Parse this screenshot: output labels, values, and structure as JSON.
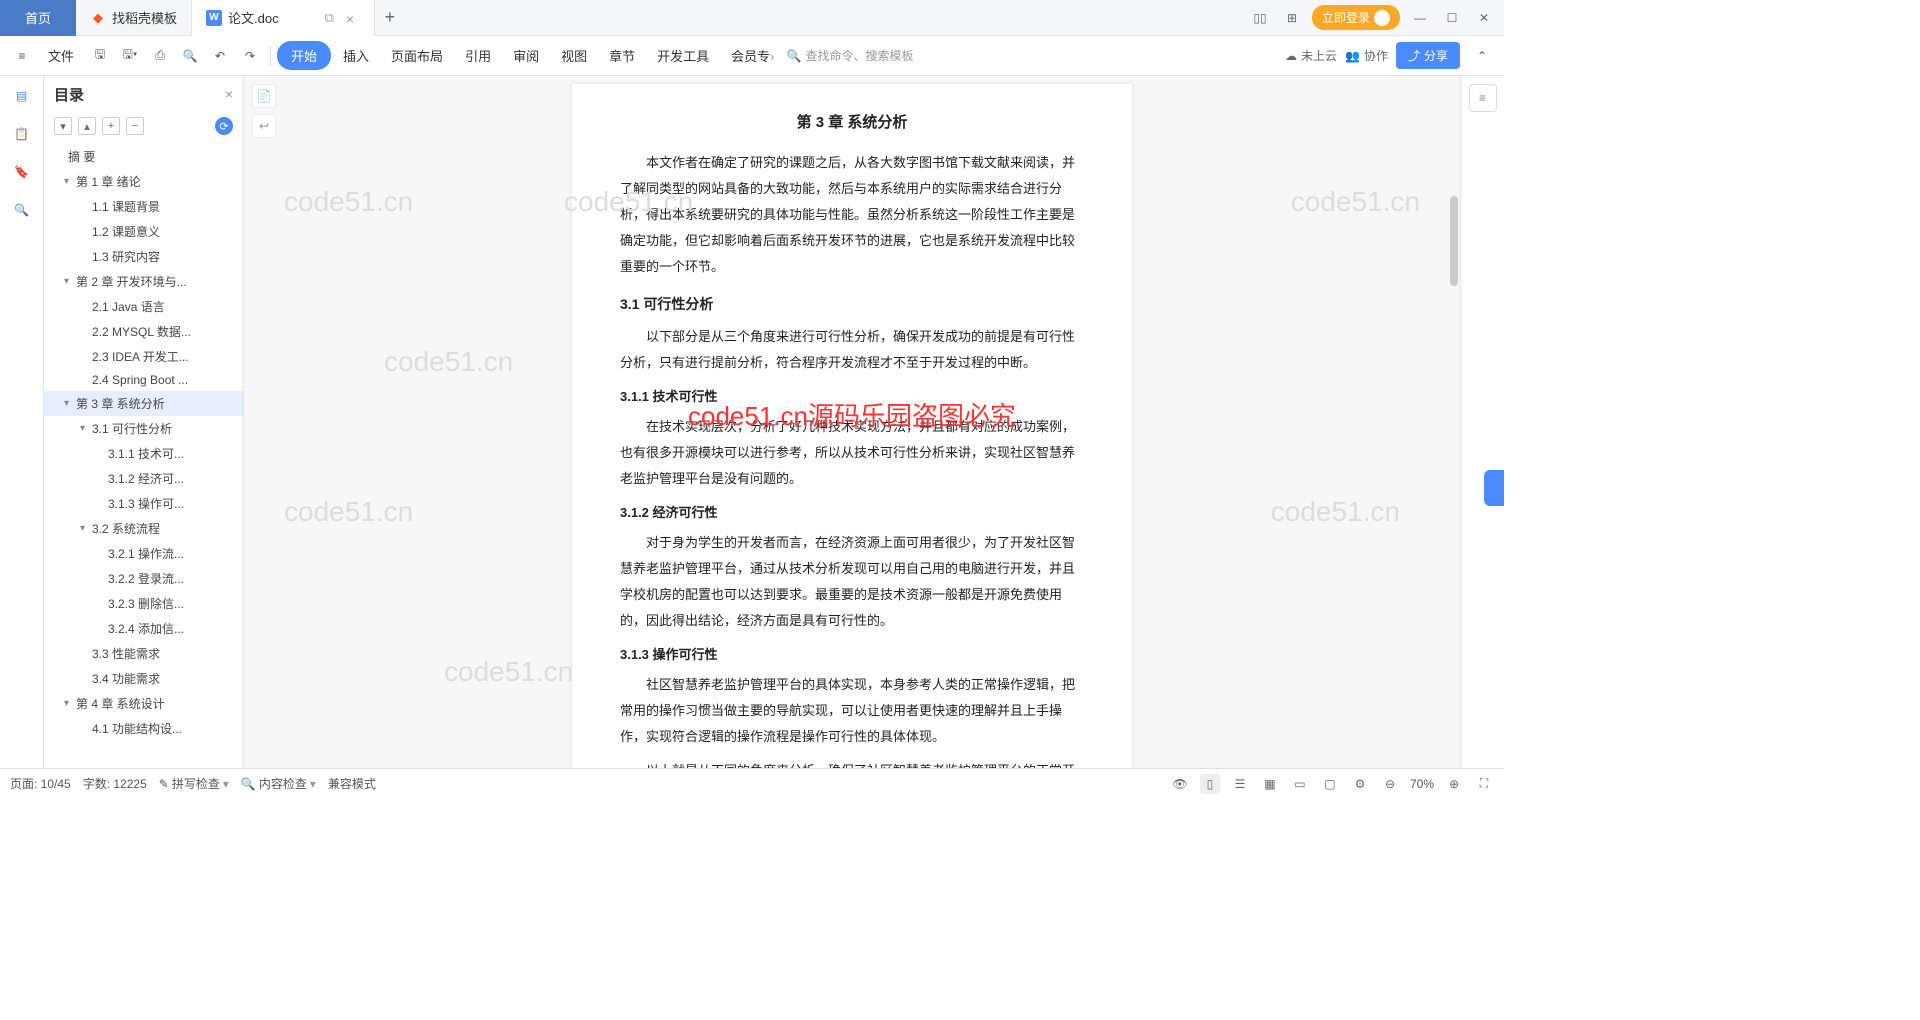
{
  "titlebar": {
    "home": "首页",
    "tabs": [
      {
        "icon": "flame",
        "label": "找稻壳模板"
      },
      {
        "icon": "wps",
        "label": "论文.doc"
      }
    ],
    "login": "立即登录"
  },
  "ribbon": {
    "file": "文件",
    "menus": [
      "开始",
      "插入",
      "页面布局",
      "引用",
      "审阅",
      "视图",
      "章节",
      "开发工具",
      "会员专"
    ],
    "search_placeholder": "查找命令、搜索模板",
    "cloud": "未上云",
    "coop": "协作",
    "share": "分享"
  },
  "outline": {
    "title": "目录",
    "items": [
      {
        "lvl": 0,
        "chev": "",
        "label": "摘  要"
      },
      {
        "lvl": 1,
        "chev": "▾",
        "label": "第 1 章  绪论"
      },
      {
        "lvl": 2,
        "chev": "",
        "label": "1.1 课题背景"
      },
      {
        "lvl": 2,
        "chev": "",
        "label": "1.2 课题意义"
      },
      {
        "lvl": 2,
        "chev": "",
        "label": "1.3 研究内容"
      },
      {
        "lvl": 1,
        "chev": "▾",
        "label": "第 2 章 开发环境与..."
      },
      {
        "lvl": 2,
        "chev": "",
        "label": "2.1 Java 语言"
      },
      {
        "lvl": 2,
        "chev": "",
        "label": "2.2 MYSQL 数据..."
      },
      {
        "lvl": 2,
        "chev": "",
        "label": "2.3 IDEA 开发工..."
      },
      {
        "lvl": 2,
        "chev": "",
        "label": "2.4 Spring Boot ..."
      },
      {
        "lvl": 1,
        "chev": "▾",
        "label": "第 3 章  系统分析",
        "selected": true
      },
      {
        "lvl": 2,
        "chev": "▾",
        "label": "3.1 可行性分析"
      },
      {
        "lvl": 3,
        "chev": "",
        "label": "3.1.1 技术可..."
      },
      {
        "lvl": 3,
        "chev": "",
        "label": "3.1.2 经济可..."
      },
      {
        "lvl": 3,
        "chev": "",
        "label": "3.1.3 操作可..."
      },
      {
        "lvl": 2,
        "chev": "▾",
        "label": "3.2  系统流程"
      },
      {
        "lvl": 3,
        "chev": "",
        "label": "3.2.1 操作流..."
      },
      {
        "lvl": 3,
        "chev": "",
        "label": "3.2.2 登录流..."
      },
      {
        "lvl": 3,
        "chev": "",
        "label": "3.2.3 删除信..."
      },
      {
        "lvl": 3,
        "chev": "",
        "label": "3.2.4 添加信..."
      },
      {
        "lvl": 2,
        "chev": "",
        "label": "3.3 性能需求"
      },
      {
        "lvl": 2,
        "chev": "",
        "label": "3.4 功能需求"
      },
      {
        "lvl": 1,
        "chev": "▾",
        "label": "第 4 章  系统设计"
      },
      {
        "lvl": 2,
        "chev": "",
        "label": "4.1 功能结构设..."
      }
    ]
  },
  "doc": {
    "chapter": "第 3 章  系统分析",
    "p1": "本文作者在确定了研究的课题之后，从各大数字图书馆下载文献来阅读，并了解同类型的网站具备的大致功能，然后与本系统用户的实际需求结合进行分析，得出本系统要研究的具体功能与性能。虽然分析系统这一阶段性工作主要是确定功能，但它却影响着后面系统开发环节的进展，它也是系统开发流程中比较重要的一个环节。",
    "h31": "3.1  可行性分析",
    "p31": "以下部分是从三个角度来进行可行性分析，确保开发成功的前提是有可行性分析，只有进行提前分析，符合程序开发流程才不至于开发过程的中断。",
    "h311": "3.1.1  技术可行性",
    "p311a": "在技术实现层次，分析了好几种技术实现方法，并且都有对应的成功案例，也有很多开源模块可以进行参考，所以从技术可行性分析来讲，实现社区智慧养老监护管理平台是没有问题的。",
    "h312": "3.1.2  经济可行性",
    "p312": "对于身为学生的开发者而言，在经济资源上面可用者很少，为了开发社区智慧养老监护管理平台，通过从技术分析发现可以用自己用的电脑进行开发，并且学校机房的配置也可以达到要求。最重要的是技术资源一般都是开源免费使用的，因此得出结论，经济方面是具有可行性的。",
    "h313": "3.1.3  操作可行性",
    "p313": "社区智慧养老监护管理平台的具体实现，本身参考人类的正常操作逻辑，把常用的操作习惯当做主要的导航实现，可以让使用者更快速的理解并且上手操作，实现符合逻辑的操作流程是操作可行性的具体体现。",
    "p_end": "以上就是从不同的角度来分析，确保了社区智慧养老监护管理平台的正常开展。"
  },
  "status": {
    "page": "页面: 10/45",
    "words": "字数: 12225",
    "spell": "拼写检查",
    "content": "内容检查",
    "compat": "兼容模式",
    "zoom": "70%"
  },
  "watermark": "code51.cn",
  "redtext": "code51.cn源码乐园盗图必究"
}
